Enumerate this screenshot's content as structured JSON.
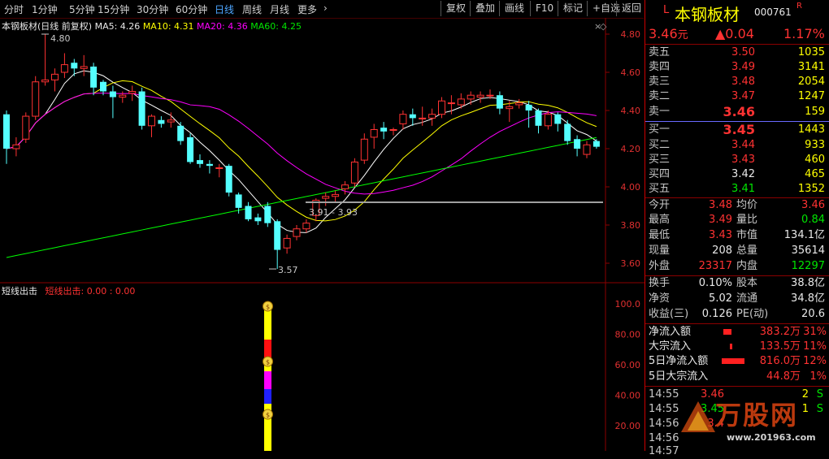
{
  "toolbar": {
    "periods": [
      "分时",
      "1分钟",
      "5分钟",
      "15分钟",
      "30分钟",
      "60分钟",
      "日线",
      "周线",
      "月线",
      "更多"
    ],
    "active_period": "日线",
    "buttons": [
      "复权",
      "叠加",
      "画线",
      "F10",
      "标记",
      "+自选",
      "返回"
    ]
  },
  "chart_legend": {
    "title": "本钢板材(日线 前复权)",
    "ma5": "MA5: 4.26",
    "ma10": "MA10: 4.31",
    "ma20": "MA20: 4.36",
    "ma60": "MA60: 4.25"
  },
  "price_axis": [
    "4.80",
    "4.60",
    "4.40",
    "4.20",
    "4.00",
    "3.80",
    "3.60"
  ],
  "annotations": {
    "high": "4.80",
    "low": "3.57",
    "range": "3.91 - 3.93"
  },
  "indicator": {
    "title": "短线出击",
    "values": "短线出击: 0.00 : 0.00",
    "axis": [
      "100.0",
      "80.00",
      "60.00",
      "40.00",
      "20.00"
    ]
  },
  "stock": {
    "prefix": "L",
    "name": "本钢板材",
    "code": "000761",
    "suffix": "R",
    "price": "3.46",
    "price_unit": "元",
    "change": "▲0.04",
    "change_pct": "1.17%"
  },
  "order_book": {
    "asks": [
      {
        "label": "卖五",
        "price": "3.50",
        "vol": "1035"
      },
      {
        "label": "卖四",
        "price": "3.49",
        "vol": "3141"
      },
      {
        "label": "卖三",
        "price": "3.48",
        "vol": "2054"
      },
      {
        "label": "卖二",
        "price": "3.47",
        "vol": "1247"
      },
      {
        "label": "卖一",
        "price": "3.46",
        "vol": "159"
      }
    ],
    "bids": [
      {
        "label": "买一",
        "price": "3.45",
        "vol": "1443"
      },
      {
        "label": "买二",
        "price": "3.44",
        "vol": "933"
      },
      {
        "label": "买三",
        "price": "3.43",
        "vol": "460"
      },
      {
        "label": "买四",
        "price": "3.42",
        "vol": "465"
      },
      {
        "label": "买五",
        "price": "3.41",
        "vol": "1352"
      }
    ]
  },
  "quote": {
    "open_l": "今开",
    "open": "3.48",
    "avg_l": "均价",
    "avg": "3.46",
    "high_l": "最高",
    "high": "3.49",
    "vr_l": "量比",
    "vr": "0.84",
    "low_l": "最低",
    "low": "3.43",
    "mcap_l": "市值",
    "mcap": "134.1亿",
    "cur_l": "现量",
    "cur": "208",
    "tot_l": "总量",
    "tot": "35614",
    "out_l": "外盘",
    "out": "23317",
    "in_l": "内盘",
    "in": "12297"
  },
  "fundamentals": {
    "turn_l": "换手",
    "turn": "0.10%",
    "cap_l": "股本",
    "cap": "38.8亿",
    "nav_l": "净资",
    "nav": "5.02",
    "float_l": "流通",
    "float": "34.8亿",
    "eps_l": "收益(三)",
    "eps": "0.126",
    "pe_l": "PE(动)",
    "pe": "20.6"
  },
  "flows": [
    {
      "label": "净流入额",
      "value": "383.2万",
      "pct": "31%"
    },
    {
      "label": "大宗流入",
      "value": "133.5万",
      "pct": "11%"
    },
    {
      "label": "5日净流入额",
      "value": "816.0万",
      "pct": "12%"
    },
    {
      "label": "5日大宗流入",
      "value": "44.8万",
      "pct": "1%"
    }
  ],
  "ticks": [
    {
      "time": "14:55",
      "price": "3.46",
      "vol": "2",
      "side": "S"
    },
    {
      "time": "14:55",
      "price": "3.45",
      "vol": "1",
      "side": "S"
    },
    {
      "time": "14:56",
      "price": "3.4",
      "vol": "",
      "side": ""
    },
    {
      "time": "14:56",
      "price": "",
      "vol": "",
      "side": ""
    },
    {
      "time": "14:57",
      "price": "",
      "vol": "",
      "side": ""
    }
  ],
  "watermark": {
    "brand": "万股网",
    "url": "www.201963.com"
  },
  "colors": {
    "up": "#ff3232",
    "down": "#54ffff",
    "ma5": "#ffffff",
    "ma10": "#ffff00",
    "ma20": "#ff00ff",
    "ma60": "#00ff00",
    "grid": "#8b0000"
  }
}
